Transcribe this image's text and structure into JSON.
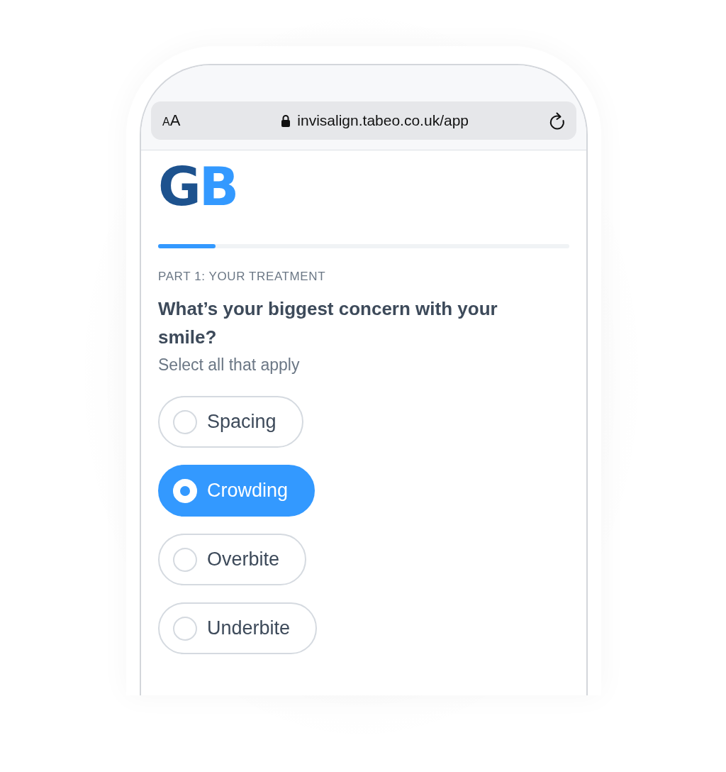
{
  "browser": {
    "text_size_label": "AA",
    "url": "invisalign.tabeo.co.uk/app"
  },
  "logo": {
    "letters": [
      {
        "text": "G",
        "color": "#1d528e"
      },
      {
        "text": "B",
        "color": "#3399ff"
      }
    ]
  },
  "progress": {
    "level": 0.14
  },
  "section_label": "PART 1: YOUR TREATMENT",
  "question": "What’s your biggest concern with your smile?",
  "hint": "Select all that apply",
  "options": [
    {
      "label": "Spacing",
      "selected": false
    },
    {
      "label": "Crowding",
      "selected": true
    },
    {
      "label": "Overbite",
      "selected": false
    },
    {
      "label": "Underbite",
      "selected": false
    }
  ]
}
